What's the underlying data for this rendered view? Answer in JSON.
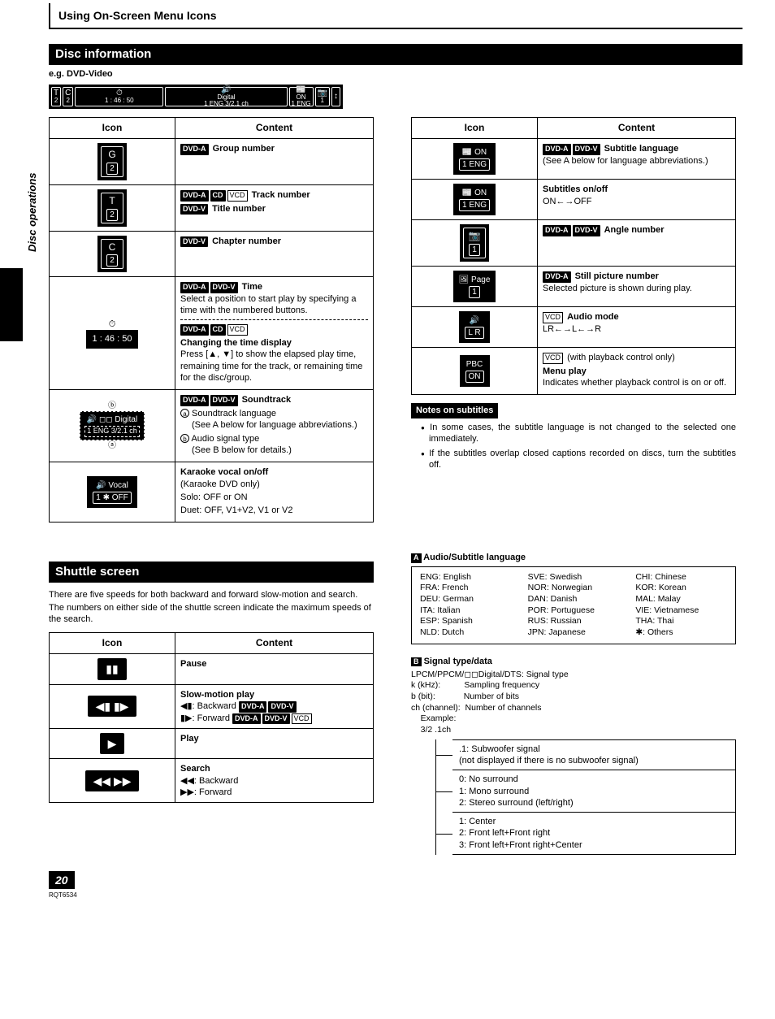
{
  "page": {
    "title": "Using On-Screen Menu Icons",
    "side_label": "Disc operations",
    "page_number": "20",
    "doc_number": "RQT6534"
  },
  "sections": {
    "disc_info": {
      "title": "Disc information",
      "example_prefix": "e.g.",
      "example_type": "DVD-Video",
      "osd": {
        "group": "2",
        "title": "2",
        "time": "1 : 46 : 50",
        "digital": "Digital",
        "audio_info": "1 ENG 3/2.1 ch",
        "sub_on": "ON",
        "sub_lang": "1 ENG",
        "angle": "1"
      },
      "headers": {
        "icon": "Icon",
        "content": "Content"
      },
      "rows_left": [
        {
          "icon": {
            "type": "cap",
            "sym": "G",
            "val": "2"
          },
          "content": [
            {
              "badges": [
                "DVD-A"
              ],
              "bold": "Group number"
            }
          ]
        },
        {
          "icon": {
            "type": "cap",
            "sym": "T",
            "val": "2"
          },
          "content": [
            {
              "badges": [
                "DVD-A",
                "CD"
              ],
              "outlines": [
                "VCD"
              ],
              "bold": "Track number"
            },
            {
              "badges": [
                "DVD-V"
              ],
              "bold": "Title number"
            }
          ]
        },
        {
          "icon": {
            "type": "cap",
            "sym": "C",
            "val": "2"
          },
          "content": [
            {
              "badges": [
                "DVD-V"
              ],
              "bold": "Chapter number"
            }
          ]
        },
        {
          "icon": {
            "type": "time",
            "sym": "⏱",
            "val": "1 : 46 : 50"
          },
          "content": [
            {
              "badges": [
                "DVD-A",
                "DVD-V"
              ],
              "bold": "Time",
              "text": "Select a position to start play by specifying a time with the numbered buttons."
            },
            {
              "divider": true
            },
            {
              "badges": [
                "DVD-A",
                "CD"
              ],
              "outlines": [
                "VCD"
              ]
            },
            {
              "bold": "Changing the time display",
              "text": "Press [▲, ▼] to show the elapsed play time, remaining time for the track, or remaining time for the disc/group."
            }
          ]
        },
        {
          "icon": {
            "type": "sound",
            "top_label": "ⓑ",
            "line1": "🔊 ◻◻ Digital",
            "line2": "1 ENG  3/2.1 ch",
            "bot_label": "ⓐ"
          },
          "content": [
            {
              "badges": [
                "DVD-A",
                "DVD-V"
              ],
              "bold": "Soundtrack"
            },
            {
              "circled": "a",
              "text": "Soundtrack language",
              "sub": "(See A below for language abbreviations.)"
            },
            {
              "circled": "b",
              "text": "Audio signal type",
              "sub": "(See B below for details.)"
            }
          ]
        },
        {
          "divider_row": true,
          "icon": {
            "type": "vocal",
            "line1": "🔊    Vocal",
            "line2": "1  ✱        OFF"
          },
          "content": [
            {
              "bold": "Karaoke vocal on/off",
              "text": "(Karaoke DVD only)"
            },
            {
              "text": "Solo:  OFF or ON"
            },
            {
              "text": "Duet:  OFF, V1+V2, V1 or V2"
            }
          ]
        }
      ],
      "rows_right": [
        {
          "icon": {
            "type": "sub",
            "line1": "📰    ON",
            "line2": "1 ENG"
          },
          "content": [
            {
              "badges": [
                "DVD-A",
                "DVD-V"
              ],
              "bold": "Subtitle language",
              "text": "(See A below for language abbreviations.)"
            }
          ]
        },
        {
          "divider_row": true,
          "icon": {
            "type": "sub",
            "line1": "📰    ON",
            "line2": "1 ENG"
          },
          "content": [
            {
              "bold": "Subtitles on/off",
              "text": "ON←→OFF"
            }
          ]
        },
        {
          "icon": {
            "type": "cap",
            "sym": "📷",
            "val": "1"
          },
          "content": [
            {
              "badges": [
                "DVD-A",
                "DVD-V"
              ],
              "bold": "Angle number"
            }
          ]
        },
        {
          "icon": {
            "type": "page",
            "line1": "🖼 Page",
            "line2": "1"
          },
          "content": [
            {
              "badges": [
                "DVD-A"
              ],
              "bold": "Still picture number",
              "text": "Selected picture is shown during play."
            }
          ]
        },
        {
          "icon": {
            "type": "audio",
            "line1": "🔊",
            "line2": "L R"
          },
          "content": [
            {
              "outlines": [
                "VCD"
              ],
              "bold": "Audio mode",
              "text": "LR←→L←→R"
            }
          ]
        },
        {
          "icon": {
            "type": "pbc",
            "line1": "PBC",
            "line2": "ON"
          },
          "content": [
            {
              "outlines": [
                "VCD"
              ],
              "text_after": "(with playback control only)"
            },
            {
              "bold": "Menu play",
              "text": "Indicates whether playback control is on or off."
            }
          ]
        }
      ],
      "notes": {
        "title": "Notes on subtitles",
        "items": [
          "In some cases, the subtitle language is not changed to the selected one immediately.",
          "If the subtitles overlap closed captions recorded on discs, turn the subtitles off."
        ]
      }
    },
    "shuttle": {
      "title": "Shuttle screen",
      "intro1": "There are five speeds for both backward and forward slow-motion and search.",
      "intro2": "The numbers on either side of the shuttle screen indicate the maximum speeds of the search.",
      "headers": {
        "icon": "Icon",
        "content": "Content"
      },
      "rows": [
        {
          "icon": "▮▮",
          "content": [
            {
              "bold": "Pause"
            }
          ]
        },
        {
          "icon": "◀▮  ▮▶",
          "content": [
            {
              "bold": "Slow-motion play"
            },
            {
              "text": "◀▮: Backward",
              "badges": [
                "DVD-A",
                "DVD-V"
              ]
            },
            {
              "text": "▮▶: Forward",
              "badges": [
                "DVD-A",
                "DVD-V"
              ],
              "outlines": [
                "VCD"
              ]
            }
          ]
        },
        {
          "icon": "▶",
          "content": [
            {
              "bold": "Play"
            }
          ]
        },
        {
          "icon": "◀◀  ▶▶",
          "content": [
            {
              "bold": "Search"
            },
            {
              "text": "◀◀: Backward"
            },
            {
              "text": "▶▶: Forward"
            }
          ]
        }
      ]
    },
    "reference": {
      "lang": {
        "label_letter": "A",
        "title": "Audio/Subtitle language",
        "cols": [
          [
            "ENG: English",
            "FRA: French",
            "DEU: German",
            "ITA: Italian",
            "ESP: Spanish",
            "NLD: Dutch"
          ],
          [
            "SVE: Swedish",
            "NOR: Norwegian",
            "DAN: Danish",
            "POR: Portuguese",
            "RUS: Russian",
            "JPN: Japanese"
          ],
          [
            "CHI: Chinese",
            "KOR: Korean",
            "MAL: Malay",
            "VIE: Vietnamese",
            "THA: Thai",
            "✱: Others"
          ]
        ]
      },
      "signal": {
        "label_letter": "B",
        "title": "Signal type/data",
        "lines": [
          "LPCM/PPCM/◻◻Digital/DTS: Signal type",
          "k (kHz):          Sampling frequency",
          "b (bit):            Number of bits",
          "ch (channel):  Number of channels",
          "    Example:",
          "    3/2 .1ch"
        ],
        "boxes": [
          [
            ".1: Subwoofer signal",
            "(not displayed if there is no subwoofer signal)"
          ],
          [
            "0: No surround",
            "1: Mono surround",
            "2: Stereo surround (left/right)"
          ],
          [
            "1: Center",
            "2: Front left+Front right",
            "3: Front left+Front right+Center"
          ]
        ]
      }
    }
  }
}
